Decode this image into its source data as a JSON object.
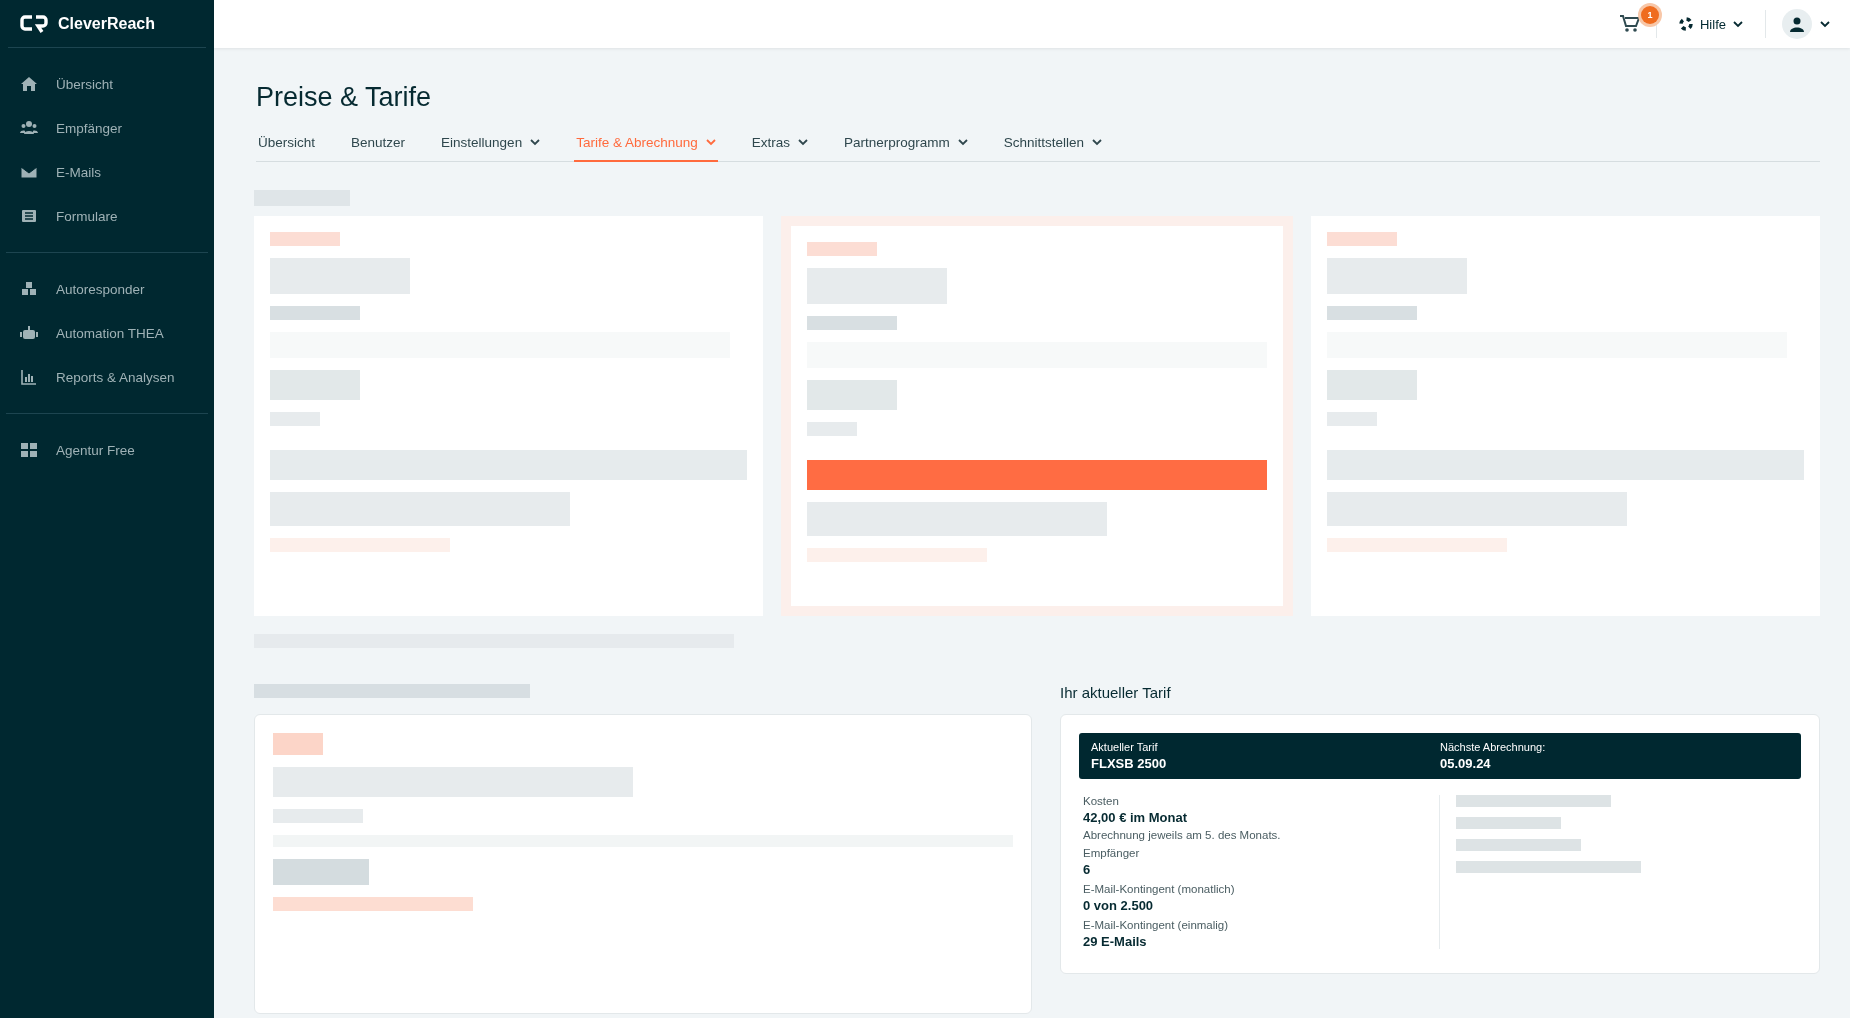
{
  "sidebar": {
    "logo": "CleverReach",
    "groups": [
      {
        "items": [
          {
            "kind": "home",
            "label": "Übersicht"
          },
          {
            "kind": "users",
            "label": "Empfänger"
          },
          {
            "kind": "mail",
            "label": "E-Mails"
          },
          {
            "kind": "form",
            "label": "Formulare"
          }
        ]
      },
      {
        "items": [
          {
            "kind": "cubes",
            "label": "Autoresponder"
          },
          {
            "kind": "robot",
            "label": "Automation THEA"
          },
          {
            "kind": "chart",
            "label": "Reports & Analysen"
          }
        ]
      },
      {
        "items": [
          {
            "kind": "grid",
            "label": "Agentur Free"
          }
        ]
      }
    ]
  },
  "topbar": {
    "cart_count": "1",
    "help": "Hilfe"
  },
  "page": {
    "title": "Preise & Tarife",
    "tabs": [
      {
        "label": "Übersicht",
        "dropdown": false,
        "selected": false
      },
      {
        "label": "Benutzer",
        "dropdown": false,
        "selected": false
      },
      {
        "label": "Einstellungen",
        "dropdown": true,
        "selected": false
      },
      {
        "label": "Tarife & Abrechnung",
        "dropdown": true,
        "selected": true
      },
      {
        "label": "Extras",
        "dropdown": true,
        "selected": false
      },
      {
        "label": "Partnerprogramm",
        "dropdown": true,
        "selected": false
      },
      {
        "label": "Schnittstellen",
        "dropdown": true,
        "selected": false
      }
    ]
  },
  "plans": [
    {
      "highlighted": false
    },
    {
      "highlighted": true
    },
    {
      "highlighted": false
    }
  ],
  "current_tariff": {
    "heading": "Ihr aktueller Tarif",
    "banner": [
      {
        "label": "Aktueller Tarif",
        "value": "FLXSB 2500"
      },
      {
        "label": "Nächste Abrechnung:",
        "value": "05.09.24"
      }
    ],
    "details": [
      {
        "label": "Kosten",
        "value": "42,00 € im Monat",
        "note": "Abrechnung jeweils am 5. des Monats."
      },
      {
        "label": "Empfänger",
        "value": "6"
      },
      {
        "label": "E-Mail-Kontingent (monatlich)",
        "value": "0 von 2.500"
      },
      {
        "label": "E-Mail-Kontingent (einmalig)",
        "value": "29 E-Mails"
      }
    ]
  }
}
